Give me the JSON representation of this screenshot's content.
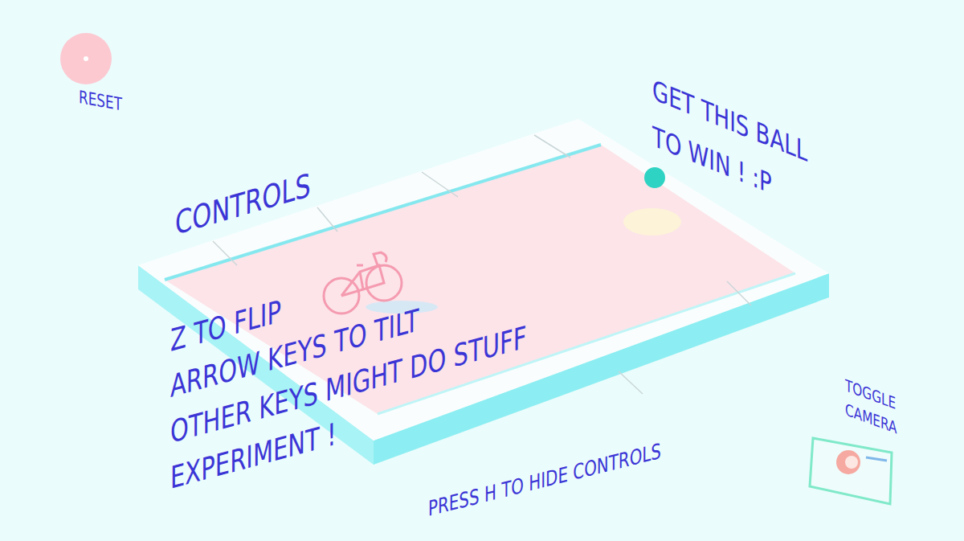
{
  "reset": {
    "label": "RESET"
  },
  "controls": {
    "title": "CONTROLS",
    "lines": [
      "Z TO FLIP",
      "ARROW KEYS TO TILT",
      "OTHER KEYS MIGHT DO STUFF",
      "EXPERIMENT !"
    ]
  },
  "goal": {
    "lines": [
      "GET THIS BALL",
      "TO WIN ! :P"
    ]
  },
  "hint": "PRESS H TO HIDE CONTROLS",
  "camera": {
    "lines": [
      "TOGGLE",
      "CAMERA"
    ]
  }
}
